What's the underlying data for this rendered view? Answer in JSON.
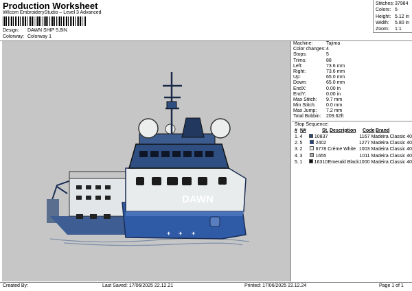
{
  "header": {
    "title": "Production Worksheet",
    "subtitle": "Wilcom EmbroideryStudio – Level 3 Advanced",
    "design_label": "Design:",
    "design_value": "DAWN SHIP 5,8IN",
    "colorway_label": "Colorway:",
    "colorway_value": "Colorway 1"
  },
  "stats": [
    {
      "k": "Stitches:",
      "v": "37984"
    },
    {
      "k": "Colors:",
      "v": "5"
    },
    {
      "k": "Height:",
      "v": "5.12 in"
    },
    {
      "k": "Width:",
      "v": "5.80 in"
    },
    {
      "k": "Zoom:",
      "v": "1:1"
    }
  ],
  "info": [
    {
      "k": "Machine:",
      "v": "Tajima"
    },
    {
      "k": "Color changes:",
      "v": "4"
    },
    {
      "k": "Stops:",
      "v": "5"
    },
    {
      "k": "Trims:",
      "v": "88"
    },
    {
      "k": "Left:",
      "v": "73.6 mm"
    },
    {
      "k": "Right:",
      "v": "73.6 mm"
    },
    {
      "k": "Up:",
      "v": "65.0 mm"
    },
    {
      "k": "Down:",
      "v": "65.0 mm"
    },
    {
      "k": "EndX:",
      "v": "0.00 in"
    },
    {
      "k": "EndY:",
      "v": "0.00 in"
    },
    {
      "k": "Max Stitch:",
      "v": "9.7 mm"
    },
    {
      "k": "Min Stitch:",
      "v": "0.0 mm"
    },
    {
      "k": "Max Jump:",
      "v": "7.2 mm"
    },
    {
      "k": "Total Bobbin:",
      "v": "209.62ft"
    }
  ],
  "stop_sequence": {
    "title": "Stop Sequence:",
    "headers": {
      "num": "#",
      "n": "N#",
      "st": "St.",
      "desc": "Description",
      "code": "Code",
      "brand": "Brand"
    },
    "rows": [
      {
        "num": "1.",
        "n": "4",
        "color": "#2c4b7c",
        "st": "10837",
        "desc": "",
        "code": "1167",
        "brand": "Madeira Classic 40"
      },
      {
        "num": "2.",
        "n": "5",
        "color": "#1f3f8f",
        "st": "2402",
        "desc": "",
        "code": "1277",
        "brand": "Madeira Classic 40"
      },
      {
        "num": "3.",
        "n": "2",
        "color": "#f4f1e6",
        "st": "6778",
        "desc": "Crème White",
        "code": "1003",
        "brand": "Madeira Classic 40"
      },
      {
        "num": "4.",
        "n": "3",
        "color": "#a9abae",
        "st": "1655",
        "desc": "",
        "code": "1011",
        "brand": "Madeira Classic 40"
      },
      {
        "num": "5.",
        "n": "1",
        "color": "#111111",
        "st": "16310",
        "desc": "Emerald Black",
        "code": "1000",
        "brand": "Madeira Classic 40"
      }
    ]
  },
  "design": {
    "hull_text": "DAWN",
    "colors": {
      "canvas": "#c6c6c6",
      "hull_blue": "#2f5aa6",
      "hull_dark": "#1c3566",
      "cream": "#e9ecec",
      "grey": "#7e8a95",
      "black": "#111111"
    }
  },
  "footer": {
    "created": "Created By:",
    "last_saved": "Last Saved: 17/06/2025 22.12.21",
    "printed": "Printed: 17/06/2025 22.12.24",
    "page": "Page 1 of 1"
  }
}
